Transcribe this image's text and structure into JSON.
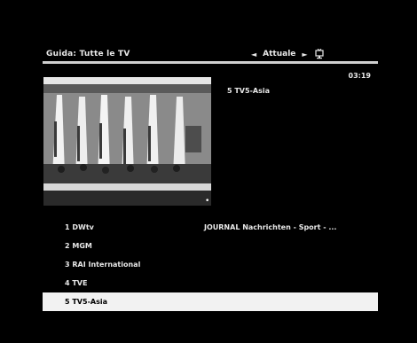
{
  "header": {
    "title": "Guida: Tutte le TV"
  },
  "nav": {
    "left_arrow": "◄",
    "label": "Attuale",
    "right_arrow": "►"
  },
  "clock": "03:19",
  "preview": {
    "channel_label": "5 TV5-Asia"
  },
  "channels": [
    {
      "name": "1 DWtv",
      "program": "JOURNAL Nachrichten - Sport - ..."
    },
    {
      "name": "2 MGM",
      "program": ""
    },
    {
      "name": "3 RAI International",
      "program": ""
    },
    {
      "name": "4 TVE",
      "program": ""
    },
    {
      "name": "5 TV5-Asia",
      "program": "",
      "selected": true
    }
  ],
  "icons": {
    "tv": "tv-guide-icon"
  }
}
